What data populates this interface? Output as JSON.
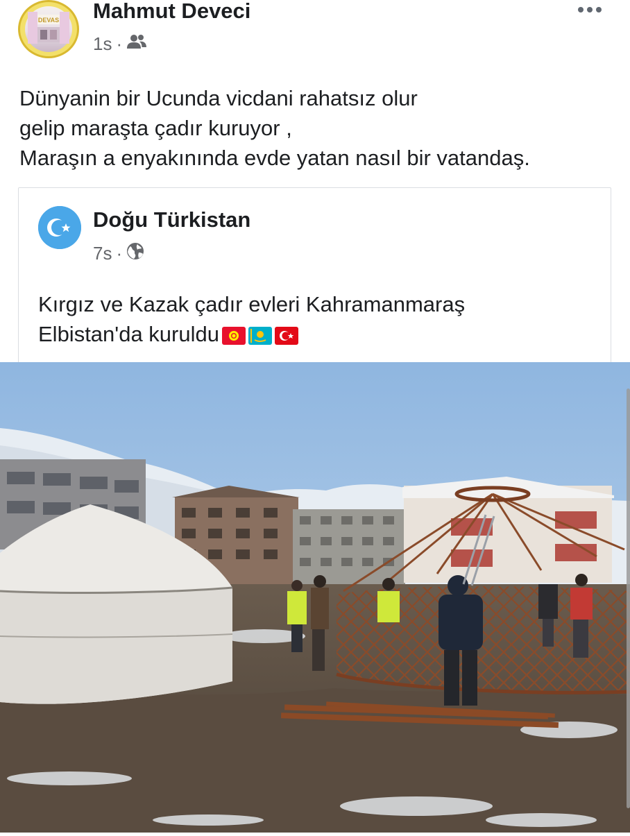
{
  "post": {
    "author": "Mahmut Deveci",
    "time": "1s",
    "separator": "·",
    "audience_icon": "friends-icon",
    "more_icon": "more-options-icon",
    "avatar_logo_text": "DEVAS",
    "text_lines": [
      "Dünyanin bir Ucunda vicdani rahatsız olur",
      "gelip maraşta çadır kuruyor ,",
      "Maraşın a enyakınında evde yatan nasıl bir vatandaş."
    ]
  },
  "shared": {
    "page_name": "Doğu Türkistan",
    "time": "7s",
    "separator": "·",
    "audience_icon": "globe-icon",
    "avatar_icon": "east-turkestan-flag-icon",
    "text_line1": "Kırgız ve Kazak çadır evleri Kahramanmaraş",
    "text_line2": "Elbistan'da kuruldu",
    "flags": [
      "kyrgyzstan-flag-icon",
      "kazakhstan-flag-icon",
      "turkey-flag-icon"
    ]
  },
  "photo": {
    "description_icon": "yurt-construction-photo"
  },
  "colors": {
    "text": "#1c1e21",
    "meta": "#65676b",
    "card_border": "#dadde1",
    "sky": "#a9c9ea"
  }
}
